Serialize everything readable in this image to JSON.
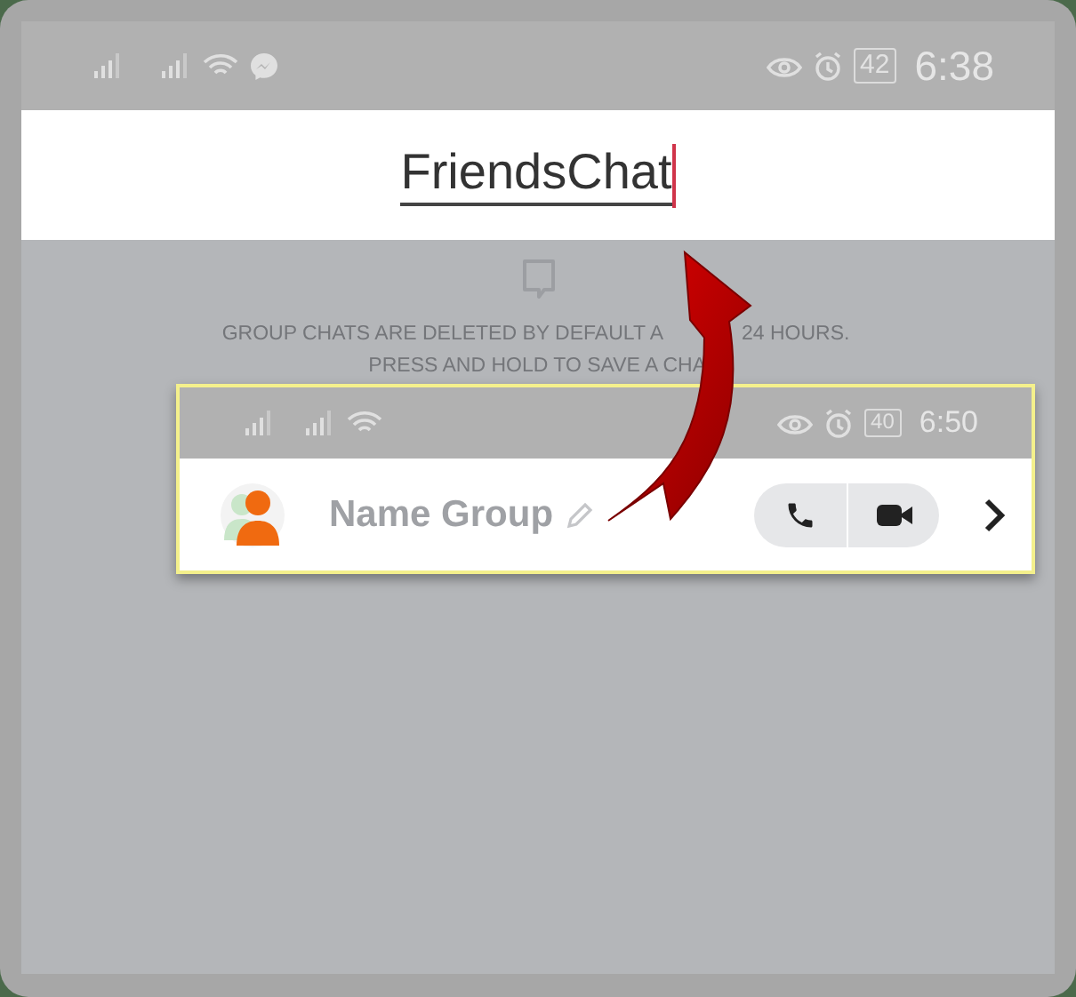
{
  "status_bar": {
    "battery": "42",
    "time": "6:38"
  },
  "group_name": {
    "value": "FriendsChat",
    "focused": true
  },
  "notice": {
    "line_1_start": "GROUP CHATS ARE DELETED BY DEFAULT A",
    "line_1_end": "24 HOURS.",
    "line_2": "PRESS AND HOLD TO SAVE A CHA"
  },
  "inset": {
    "status_bar": {
      "battery": "40",
      "time": "6:50"
    },
    "name_placeholder": "Name Group"
  }
}
